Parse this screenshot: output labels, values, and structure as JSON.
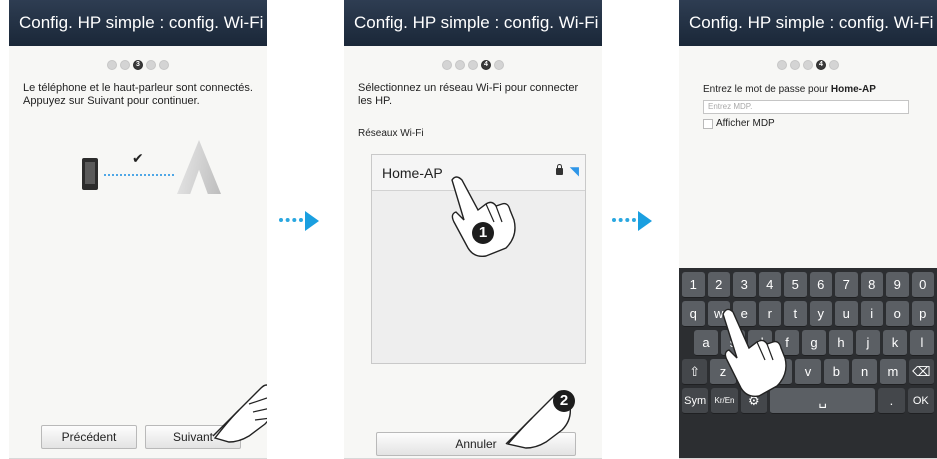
{
  "screens": [
    {
      "title": "Config. HP simple : config. Wi-Fi",
      "step_active": "3",
      "message": "Le téléphone et le haut-parleur sont connectés.\nAppuyez sur Suivant pour continuer.",
      "buttons": {
        "prev": "Précédent",
        "next": "Suivant"
      }
    },
    {
      "title": "Config. HP simple : config. Wi-Fi",
      "step_active": "4",
      "message": "Sélectionnez un réseau Wi-Fi pour connecter les HP.",
      "section_label": "Réseaux Wi-Fi",
      "networks": [
        {
          "name": "Home-AP"
        }
      ],
      "buttons": {
        "cancel": "Annuler"
      },
      "callouts": [
        "1",
        "2"
      ]
    },
    {
      "title": "Config. HP simple : config. Wi-Fi",
      "step_active": "4",
      "password_prompt": "Entrez le mot de passe pour ",
      "network_name": "Home-AP",
      "password_placeholder": "Entrez MDP.",
      "show_password_label": "Afficher MDP",
      "keyboard": {
        "row1": [
          "1",
          "2",
          "3",
          "4",
          "5",
          "6",
          "7",
          "8",
          "9",
          "0"
        ],
        "row2": [
          "q",
          "w",
          "e",
          "r",
          "t",
          "y",
          "u",
          "i",
          "o",
          "p"
        ],
        "row3": [
          "a",
          "s",
          "d",
          "f",
          "g",
          "h",
          "j",
          "k",
          "l"
        ],
        "row4": [
          "⇧",
          "z",
          "x",
          "c",
          "v",
          "b",
          "n",
          "m",
          "⌫"
        ],
        "row5": [
          "Sym",
          "Kr/En",
          "⚙",
          "␣",
          ".",
          "OK"
        ]
      }
    }
  ],
  "colors": {
    "titlebar": "#1f2d40",
    "arrow": "#1a9fe0",
    "wifi": "#2f96e8"
  },
  "icons": [
    "arrow-right-icon",
    "lock-icon",
    "wifi-icon",
    "check-icon",
    "pointing-hand-icon"
  ]
}
